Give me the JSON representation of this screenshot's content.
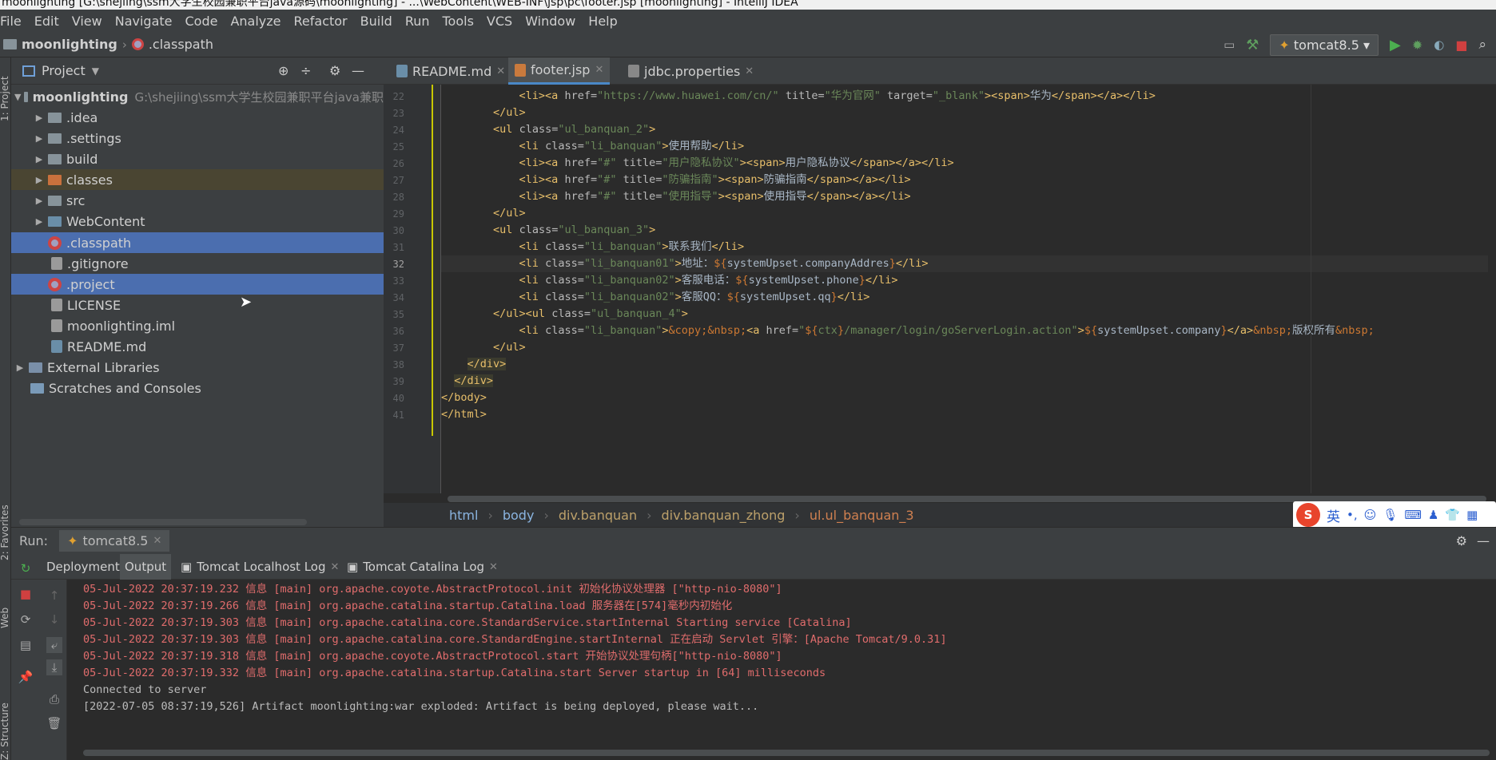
{
  "window": {
    "title": "moonlighting [G:\\shejiing\\ssm大学生校园兼职平台java源码\\moonlighting] - ...\\WebContent\\WEB-INF\\jsp\\pc\\footer.jsp [moonlighting] - IntelliJ IDEA"
  },
  "menu": [
    "File",
    "Edit",
    "View",
    "Navigate",
    "Code",
    "Analyze",
    "Refactor",
    "Build",
    "Run",
    "Tools",
    "VCS",
    "Window",
    "Help"
  ],
  "nav": {
    "project": "moonlighting",
    "file": ".classpath",
    "run_config": "tomcat8.5"
  },
  "project_panel": {
    "title": "Project",
    "root_name": "moonlighting",
    "root_path": "G:\\shejiing\\ssm大学生校园兼职平台java兼职",
    "items": [
      ".idea",
      ".settings",
      "build",
      "classes",
      "src",
      "WebContent",
      ".classpath",
      ".gitignore",
      ".project",
      "LICENSE",
      "moonlighting.iml",
      "README.md"
    ],
    "external": "External Libraries",
    "scratches": "Scratches and Consoles"
  },
  "side_labels": {
    "project": "1: Project",
    "favorites": "2: Favorites",
    "web": "Web",
    "structure": "Z: Structure"
  },
  "editor_tabs": [
    "README.md",
    "footer.jsp",
    "jdbc.properties"
  ],
  "line_numbers": [
    "22",
    "23",
    "24",
    "25",
    "26",
    "27",
    "28",
    "29",
    "30",
    "31",
    "32",
    "33",
    "34",
    "35",
    "36",
    "37",
    "38",
    "39",
    "40",
    "41"
  ],
  "breadcrumb": [
    "html",
    "body",
    "div.banquan",
    "div.banquan_zhong",
    "ul.ul_banquan_3"
  ],
  "run": {
    "label": "Run:",
    "config": "tomcat8.5",
    "tabs": [
      "Deployment",
      "Output",
      "Tomcat Localhost Log",
      "Tomcat Catalina Log"
    ]
  },
  "log": [
    "05-Jul-2022 20:37:19.232 信息 [main] org.apache.coyote.AbstractProtocol.init 初始化协议处理器 [\"http-nio-8080\"]",
    "05-Jul-2022 20:37:19.266 信息 [main] org.apache.catalina.startup.Catalina.load 服务器在[574]毫秒内初始化",
    "05-Jul-2022 20:37:19.303 信息 [main] org.apache.catalina.core.StandardService.startInternal Starting service [Catalina]",
    "05-Jul-2022 20:37:19.303 信息 [main] org.apache.catalina.core.StandardEngine.startInternal 正在启动 Servlet 引擎：[Apache Tomcat/9.0.31]",
    "05-Jul-2022 20:37:19.318 信息 [main] org.apache.coyote.AbstractProtocol.start 开始协议处理句柄[\"http-nio-8080\"]",
    "05-Jul-2022 20:37:19.332 信息 [main] org.apache.catalina.startup.Catalina.start Server startup in [64] milliseconds"
  ],
  "log_plain": [
    "Connected to server",
    "[2022-07-05 08:37:19,526] Artifact moonlighting:war exploded: Artifact is being deployed, please wait..."
  ],
  "ime": {
    "lang": "英"
  },
  "colors": {
    "tag": "#e8bf6a",
    "string": "#6a8759",
    "selection": "#4b6eaf",
    "log": "#e06c6c"
  }
}
